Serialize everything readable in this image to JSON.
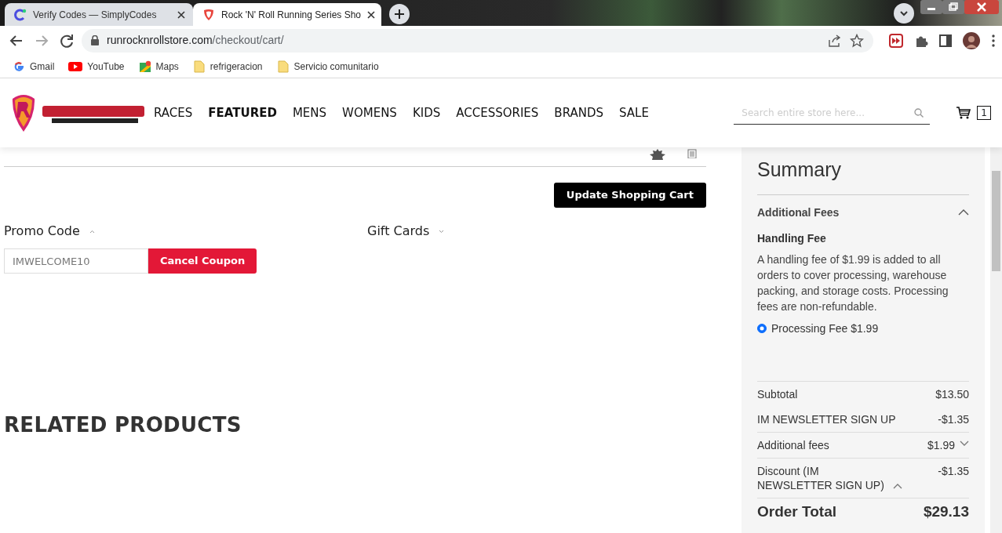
{
  "browser": {
    "tabs": [
      {
        "title": "Verify Codes — SimplyCodes",
        "selected": false
      },
      {
        "title": "Rock 'N' Roll Running Series Sho",
        "selected": true
      }
    ],
    "address": {
      "domain": "runrocknrollstore.com",
      "path": "/checkout/cart/"
    },
    "bookmarks": [
      {
        "label": "Gmail",
        "kind": "google"
      },
      {
        "label": "YouTube",
        "kind": "youtube"
      },
      {
        "label": "Maps",
        "kind": "maps"
      },
      {
        "label": "refrigeracion",
        "kind": "folder"
      },
      {
        "label": "Servicio comunitario",
        "kind": "folder"
      }
    ]
  },
  "site": {
    "nav": [
      {
        "label": "RACES",
        "selected": false
      },
      {
        "label": "FEATURED",
        "selected": true
      },
      {
        "label": "MENS",
        "selected": false
      },
      {
        "label": "WOMENS",
        "selected": false
      },
      {
        "label": "KIDS",
        "selected": false
      },
      {
        "label": "ACCESSORIES",
        "selected": false
      },
      {
        "label": "BRANDS",
        "selected": false
      },
      {
        "label": "SALE",
        "selected": false
      }
    ],
    "search": {
      "placeholder": "Search entire store here..."
    },
    "cart_count": "1"
  },
  "cart": {
    "update_button": "Update Shopping Cart",
    "promo": {
      "title": "Promo Code",
      "expanded": true,
      "value": "IMWELCOME10",
      "button": "Cancel Coupon"
    },
    "gift_cards": {
      "title": "Gift Cards",
      "expanded": false
    },
    "related_title": "RELATED PRODUCTS"
  },
  "summary": {
    "title": "Summary",
    "fees": {
      "title": "Additional Fees",
      "expanded": true,
      "fee_title": "Handling Fee",
      "description": "A handling fee of $1.99 is added to all orders to cover processing, warehouse packing, and storage costs. Processing fees are non-refundable.",
      "option": {
        "label": "Processing Fee $1.99",
        "selected": true
      }
    },
    "rows": [
      {
        "label": "Subtotal",
        "value": "$13.50",
        "kind": "plain"
      },
      {
        "label": "IM NEWSLETTER SIGN UP",
        "value": "-$1.35",
        "kind": "plain"
      },
      {
        "label": "Additional fees",
        "value": "$1.99",
        "kind": "toggle",
        "expanded": false
      },
      {
        "label": "Discount (IM NEWSLETTER SIGN UP)",
        "value": "-$1.35",
        "kind": "label-toggle",
        "expanded": true
      }
    ],
    "total": {
      "label": "Order Total",
      "value": "$29.13"
    }
  }
}
